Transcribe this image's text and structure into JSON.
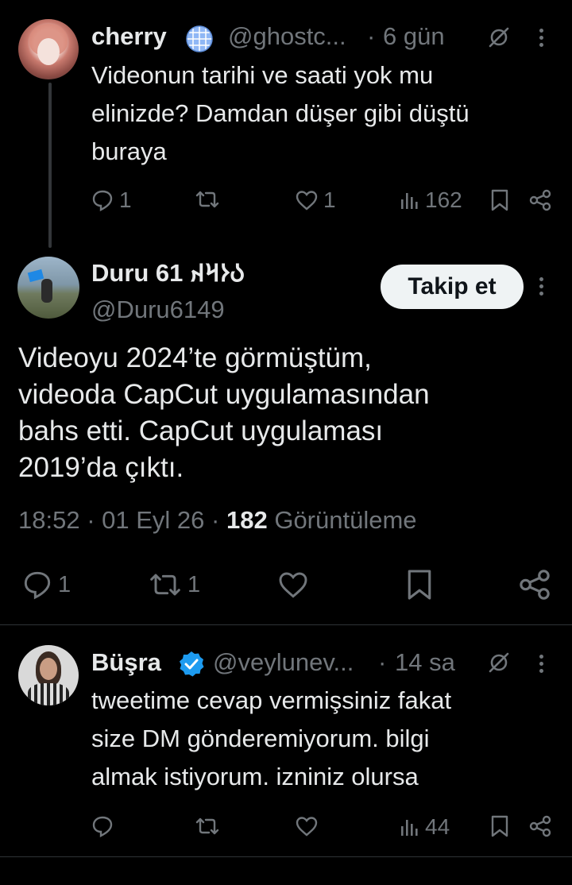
{
  "reply1": {
    "name": "cherry",
    "badge_icon": "disco-ball-icon",
    "handle": "@ghostc...",
    "sep": "·",
    "time": "6 gün",
    "text_lines": [
      "Videonun tarihi ve saati yok mu",
      "elinizde? Damdan düşer gibi düştü",
      "buraya"
    ],
    "replies": "1",
    "likes": "1",
    "views": "162"
  },
  "main_tweet": {
    "name": "Duru 61 𐰉𐰆𐰺𐰴",
    "handle": "@Duru6149",
    "follow_label": "Takip et",
    "text_lines": [
      "Videoyu 2024’te görmüştüm,",
      "videoda CapCut uygulamasından",
      "bahs etti. CapCut uygulaması",
      "2019’da çıktı."
    ],
    "time": "18:52",
    "date": "01 Eyl 26",
    "views_count": "182",
    "views_label": "Görüntüleme",
    "replies": "1",
    "reposts": "1"
  },
  "reply2": {
    "name": "Büşra",
    "handle": "@veylunev...",
    "sep": "·",
    "time": "14 sa",
    "text_lines": [
      "tweetime cevap vermişsiniz fakat",
      "size DM gönderemiyorum. bilgi",
      "almak istiyorum. izniniz olursa"
    ],
    "views": "44"
  },
  "colors": {
    "background": "#000000",
    "text": "#e7e9ea",
    "muted": "#71767b",
    "verified": "#1d9bf0",
    "divider": "#2f3336"
  }
}
